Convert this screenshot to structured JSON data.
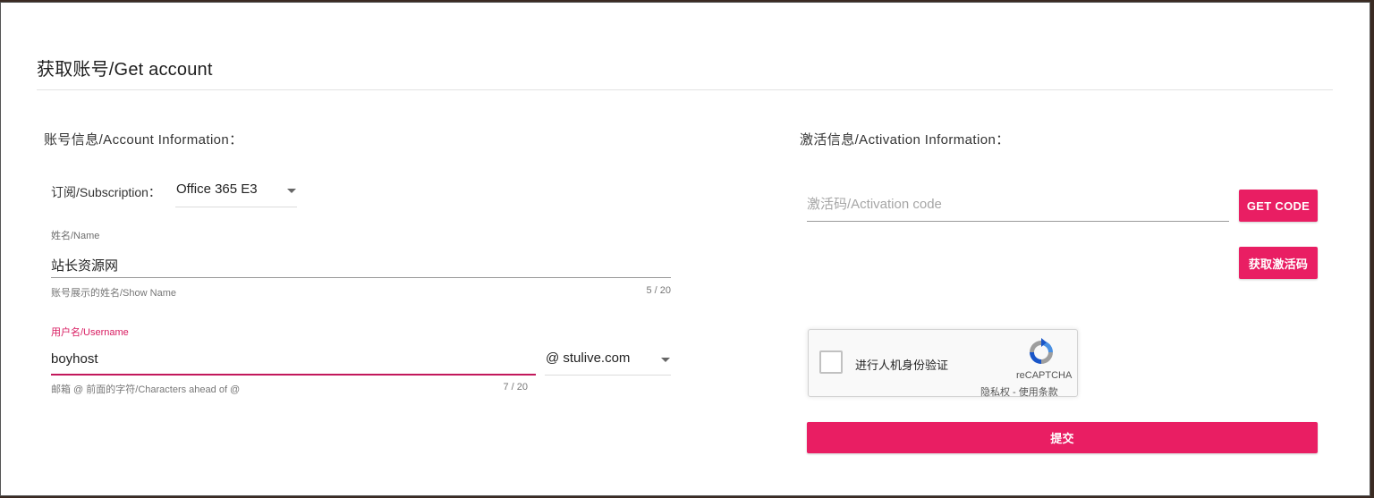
{
  "dialog": {
    "title": "获取账号/Get account"
  },
  "account": {
    "heading": "账号信息/Account Information：",
    "subscription": {
      "label": "订阅/Subscription：",
      "value": "Office 365 E3"
    },
    "name": {
      "label": "姓名/Name",
      "value": "站长资源网",
      "hint": "账号展示的姓名/Show Name",
      "counter": "5 / 20"
    },
    "username": {
      "label": "用户名/Username",
      "value": "boyhost",
      "hint": "邮箱 @ 前面的字符/Characters ahead of @",
      "counter": "7 / 20",
      "domain": "@ stulive.com"
    }
  },
  "activation": {
    "heading": "激活信息/Activation Information：",
    "code_placeholder": "激活码/Activation code",
    "get_code_label": "GET CODE",
    "get_code_cn_label": "获取激活码"
  },
  "recaptcha": {
    "label": "进行人机身份验证",
    "brand": "reCAPTCHA",
    "links": "隐私权 - 使用条款"
  },
  "submit_label": "提交",
  "colors": {
    "accent": "#e91e63",
    "active_underline": "#c2185b"
  }
}
